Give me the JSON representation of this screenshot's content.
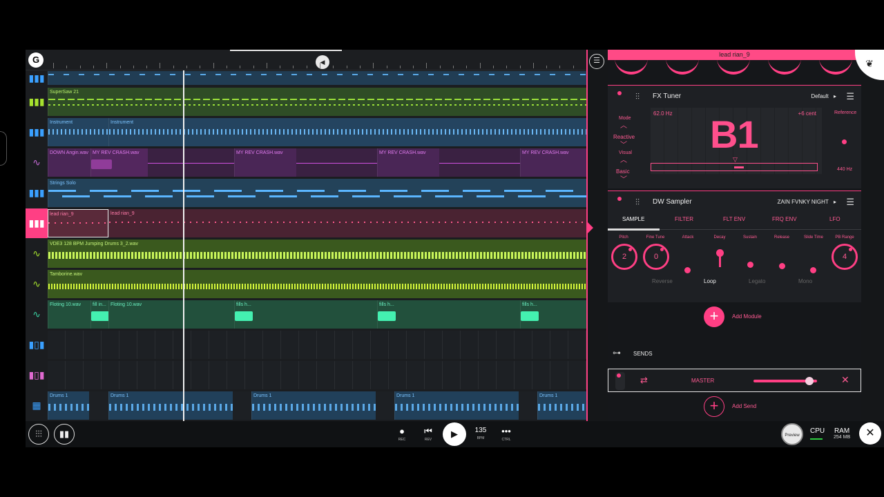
{
  "colors": {
    "accent": "#ff3f84",
    "blue_track": "#22425a",
    "green_track": "#2d4a26",
    "purple_track": "#3d2244",
    "red_track": "#4a2330",
    "lime_track": "#3e5a1e",
    "teal_track": "#1e4a3a"
  },
  "ruler": {
    "logo": "G",
    "loop_knob": "◀"
  },
  "tracks": [
    {
      "icon": "piano-icon",
      "glyph": "▮▮▮",
      "clips": []
    },
    {
      "icon": "piano-icon",
      "glyph": "▮▮▮",
      "clips": [
        "SuperSaw 21"
      ]
    },
    {
      "icon": "piano-icon",
      "glyph": "▮▮▮",
      "clips": [
        "Instrument",
        "Instrument"
      ]
    },
    {
      "icon": "waveform-icon",
      "glyph": "∿",
      "clips": [
        "DOWN Angin.wav",
        "MY REV CRASH.wav",
        "MY REV CRASH.wav",
        "MY REV CRASH.wav",
        "MY REV CRASH.wav"
      ]
    },
    {
      "icon": "piano-icon",
      "glyph": "▮▮▮",
      "clips": [
        "Strings Solo"
      ]
    },
    {
      "icon": "piano-icon",
      "glyph": "▮▮▮",
      "clips": [
        "lead rian_9",
        "lead rian_9"
      ]
    },
    {
      "icon": "waveform-icon",
      "glyph": "∿",
      "clips": [
        "VDE3 128 BPM Jumping Drums 3_2.wav"
      ]
    },
    {
      "icon": "waveform-icon",
      "glyph": "∿",
      "clips": [
        "Tamborine.wav"
      ]
    },
    {
      "icon": "waveform-icon",
      "glyph": "∿",
      "clips": [
        "Floting 10.wav",
        "fill in...",
        "Floting 10.wav",
        "fills h...",
        "fills h...",
        "fills h..."
      ]
    },
    {
      "icon": "drum-pad-icon",
      "glyph": "▮▯▮",
      "clips": []
    },
    {
      "icon": "drum-pad-icon",
      "glyph": "▮▯▮",
      "clips": []
    },
    {
      "icon": "drum-pad-icon",
      "glyph": "▦",
      "clips": [
        "Drums 1",
        "Drums 1",
        "Drums 1",
        "Drums 1",
        "Drums 1"
      ]
    }
  ],
  "panel": {
    "instrument_title": "lead rian_9",
    "fx_tuner": {
      "name": "FX Tuner",
      "preset": "Default",
      "mode_label": "Mode",
      "mode_value": "Reactive",
      "visual_label": "Visual",
      "visual_value": "Basic",
      "frequency": "62.0 Hz",
      "cents": "+6 cent",
      "note": "B1",
      "reference_label": "Reference",
      "reference_value": "440 Hz"
    },
    "sampler": {
      "name": "DW Sampler",
      "preset": "ZAIN FVNKY NIGHT",
      "tabs": [
        "SAMPLE",
        "FILTER",
        "FLT ENV",
        "FRQ ENV",
        "LFO"
      ],
      "params": [
        "Pitch",
        "Fine Tune",
        "Attack",
        "Decay",
        "Sustain",
        "Release",
        "Slide Time",
        "PB Range"
      ],
      "pitch_value": "2",
      "fine_tune_value": "0",
      "pb_range_value": "4",
      "toggles": [
        "Reverse",
        "Loop",
        "Legato",
        "Mono"
      ]
    },
    "add_module": "Add Module",
    "sends_label": "SENDS",
    "master": {
      "name": "MASTER",
      "level": 0.88
    },
    "add_send": "Add Send"
  },
  "transport": {
    "rec": "REC",
    "rev": "REV",
    "bpm_value": "135",
    "bpm_label": "BPM",
    "ctrl": "CTRL"
  },
  "status": {
    "preview": "Preview",
    "cpu": "CPU",
    "ram": "RAM",
    "ram_value": "254 MB"
  }
}
